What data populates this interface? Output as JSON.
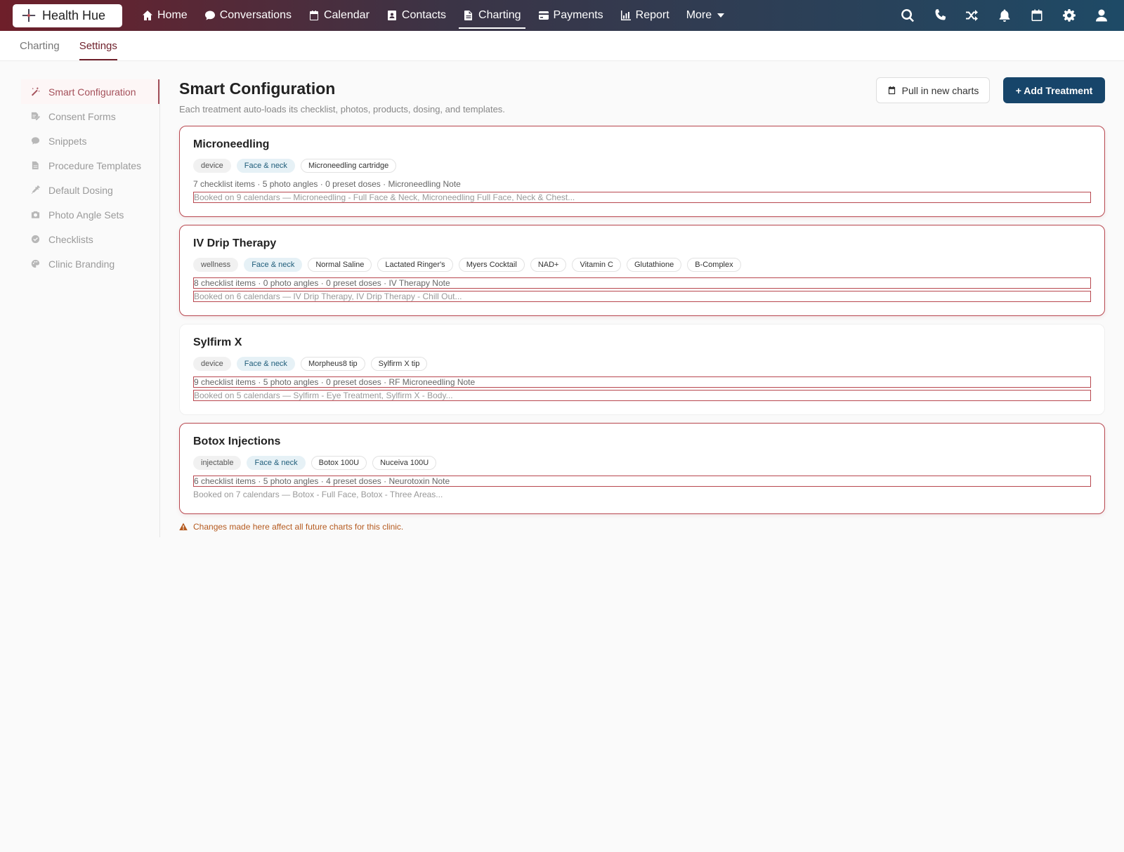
{
  "brand": {
    "name": "Health Hue"
  },
  "nav": {
    "items": [
      {
        "label": "Home",
        "icon": "home-icon"
      },
      {
        "label": "Conversations",
        "icon": "chat-icon"
      },
      {
        "label": "Calendar",
        "icon": "calendar-icon"
      },
      {
        "label": "Contacts",
        "icon": "contact-card-icon"
      },
      {
        "label": "Charting",
        "icon": "document-icon",
        "active": true
      },
      {
        "label": "Payments",
        "icon": "credit-card-icon"
      },
      {
        "label": "Report",
        "icon": "bar-chart-icon"
      },
      {
        "label": "More",
        "icon": "chevron-down-icon"
      }
    ],
    "right_icons": [
      "search-icon",
      "phone-icon",
      "shuffle-icon",
      "bell-icon",
      "calendar-icon",
      "gear-icon",
      "user-icon"
    ]
  },
  "subtabs": [
    {
      "label": "Charting",
      "active": false
    },
    {
      "label": "Settings",
      "active": true
    }
  ],
  "sidebar": {
    "items": [
      {
        "label": "Smart Configuration",
        "icon": "magic-wand-icon",
        "active": true
      },
      {
        "label": "Consent Forms",
        "icon": "signature-icon"
      },
      {
        "label": "Snippets",
        "icon": "comment-icon"
      },
      {
        "label": "Procedure Templates",
        "icon": "file-icon"
      },
      {
        "label": "Default Dosing",
        "icon": "syringe-icon"
      },
      {
        "label": "Photo Angle Sets",
        "icon": "camera-icon"
      },
      {
        "label": "Checklists",
        "icon": "check-circle-icon"
      },
      {
        "label": "Clinic Branding",
        "icon": "palette-icon"
      }
    ]
  },
  "main": {
    "title": "Smart Configuration",
    "subtitle": "Each treatment auto-loads its checklist, photos, products, dosing, and templates.",
    "pull_button": "Pull in new charts",
    "add_button": "+ Add Treatment",
    "treatments": [
      {
        "name": "Microneedling",
        "tags": [
          {
            "label": "device",
            "style": "grey"
          },
          {
            "label": "Face & neck",
            "style": "blue"
          },
          {
            "label": "Microneedling cartridge",
            "style": "outline"
          }
        ],
        "meta": "7 checklist items · 5 photo angles · 0 preset doses · Microneedling Note",
        "booked": "Booked on 9 calendars — Microneedling - Full Face & Neck, Microneedling Full Face, Neck & Chest..."
      },
      {
        "name": "IV Drip Therapy",
        "tags": [
          {
            "label": "wellness",
            "style": "grey"
          },
          {
            "label": "Face & neck",
            "style": "blue"
          },
          {
            "label": "Normal Saline",
            "style": "outline"
          },
          {
            "label": "Lactated Ringer's",
            "style": "outline"
          },
          {
            "label": "Myers Cocktail",
            "style": "outline"
          },
          {
            "label": "NAD+",
            "style": "outline"
          },
          {
            "label": "Vitamin C",
            "style": "outline"
          },
          {
            "label": "Glutathione",
            "style": "outline"
          },
          {
            "label": "B-Complex",
            "style": "outline"
          }
        ],
        "meta": "8 checklist items · 0 photo angles · 0 preset doses · IV Therapy Note",
        "booked": "Booked on 6 calendars — IV Drip Therapy, IV Drip Therapy - Chill Out..."
      },
      {
        "name": "Sylfirm X",
        "tags": [
          {
            "label": "device",
            "style": "grey"
          },
          {
            "label": "Face & neck",
            "style": "blue"
          },
          {
            "label": "Morpheus8 tip",
            "style": "outline"
          },
          {
            "label": "Sylfirm X tip",
            "style": "outline"
          }
        ],
        "meta": "9 checklist items · 5 photo angles · 0 preset doses · RF Microneedling Note",
        "booked": "Booked on 5 calendars — Sylfirm - Eye Treatment, Sylfirm X - Body..."
      },
      {
        "name": "Botox Injections",
        "tags": [
          {
            "label": "injectable",
            "style": "grey"
          },
          {
            "label": "Face & neck",
            "style": "blue"
          },
          {
            "label": "Botox 100U",
            "style": "outline"
          },
          {
            "label": "Nuceiva 100U",
            "style": "outline"
          }
        ],
        "meta": "6 checklist items · 5 photo angles · 4 preset doses · Neurotoxin Note",
        "booked": "Booked on 7 calendars — Botox - Full Face, Botox - Three Areas..."
      }
    ],
    "footnote": "Changes made here affect all future charts for this clinic."
  },
  "colors": {
    "brand_maroon": "#6e1f2a",
    "primary_blue": "#17456a",
    "card_border": "#b8474f",
    "warning": "#b55a1f"
  }
}
